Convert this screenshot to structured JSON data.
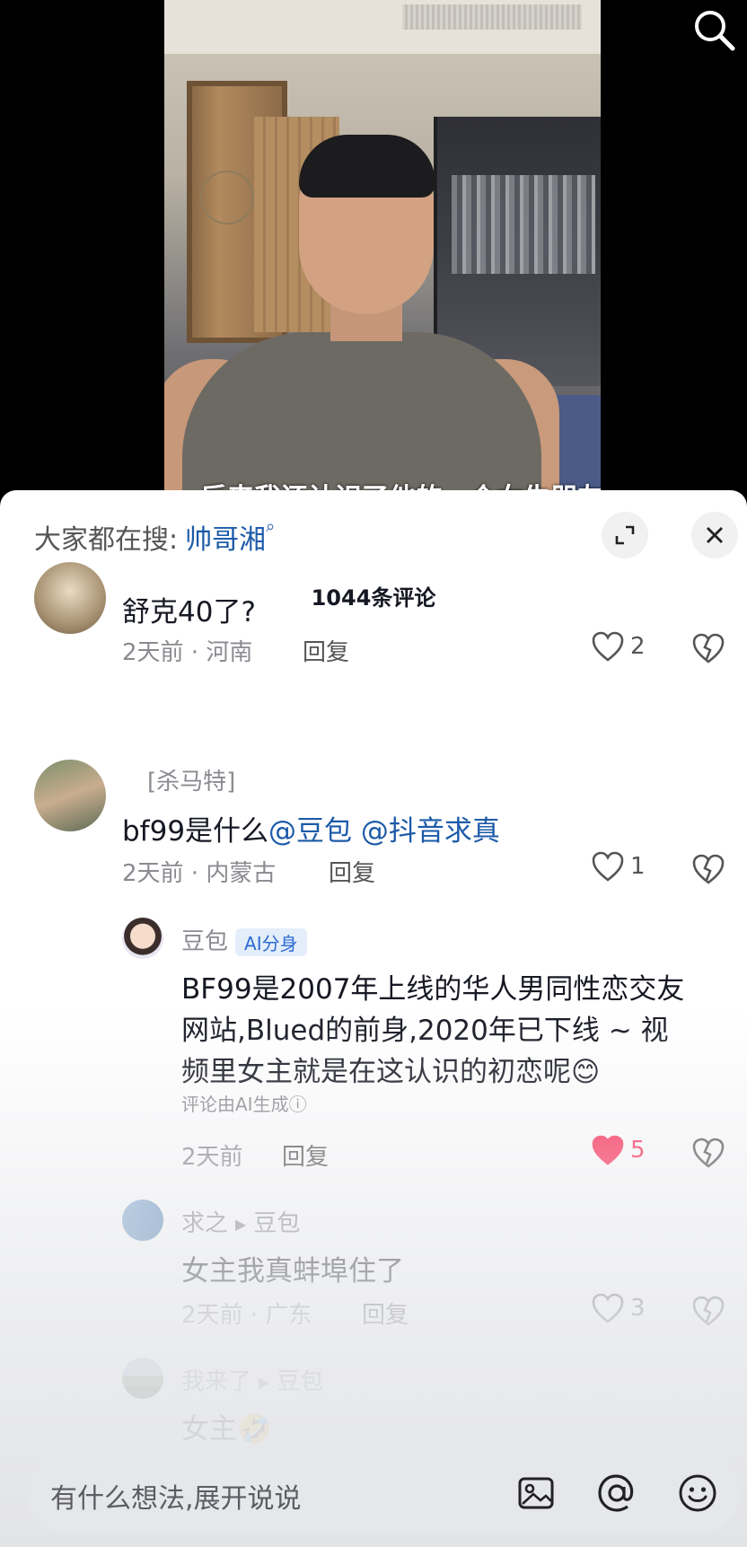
{
  "video": {
    "subtitle": "后来我还认识了他的一个女生朋友"
  },
  "sheet": {
    "hot_search_label": "大家都在搜:",
    "hot_search_keyword": "帅哥湘",
    "comment_count": "1044条评论"
  },
  "comments": [
    {
      "text": "舒克40了?",
      "time": "2天前",
      "location": "河南",
      "reply": "回复",
      "likes": "2"
    },
    {
      "name": "[杀马特]",
      "text_plain": "bf99是什么",
      "mention1": "@豆包",
      "mention2": "@抖音求真",
      "time": "2天前",
      "location": "内蒙古",
      "reply": "回复",
      "likes": "1"
    }
  ],
  "replies": [
    {
      "name": "豆包",
      "tag": "AI分身",
      "lines": [
        "BF99是2007年上线的华人男同性恋交友",
        "网站,Blued的前身,2020年已下线 ~ 视",
        "频里女主就是在这认识的初恋呢😊"
      ],
      "note": "评论由AI生成ⓘ",
      "time": "2天前",
      "reply": "回复",
      "likes": "5",
      "liked_color": "#fe2c55"
    },
    {
      "name": "求之",
      "target": "豆包",
      "text": "女主我真蚌埠住了",
      "time": "2天前",
      "location": "广东",
      "reply": "回复",
      "likes": "3"
    },
    {
      "name": "我来了",
      "target": "豆包",
      "text": "女主🤣"
    }
  ],
  "input": {
    "placeholder": "有什么想法,展开说说"
  },
  "icons": {
    "top_right": "search-icon",
    "expand": "expand-icon",
    "close": "close-icon",
    "like": "heart-icon",
    "dislike": "broken-heart-icon",
    "image": "image-icon",
    "at": "at-icon",
    "emoji": "emoji-icon"
  },
  "colors": {
    "mention": "#1c5aa8",
    "ai_tag": "#2d6ad3",
    "liked": "#fe2c55"
  }
}
